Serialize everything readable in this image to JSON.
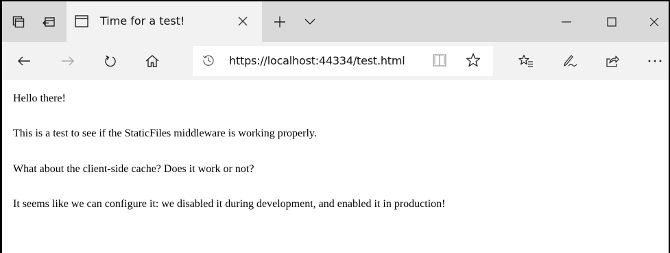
{
  "tab": {
    "title": "Time for a test!"
  },
  "address_bar": {
    "url": "https://localhost:44334/test.html"
  },
  "page": {
    "paragraphs": [
      "Hello there!",
      "This is a test to see if the StaticFiles middleware is working properly.",
      "What about the client-side cache? Does it work or not?",
      "It seems like we can configure it: we disabled it during development, and enabled it in production!"
    ]
  },
  "icons": {
    "tab_preview": "tabs-aside-icon",
    "set_aside": "set-tabs-aside-icon",
    "page": "page-icon",
    "close_tab": "close-icon",
    "new_tab": "plus-icon",
    "tab_list": "chevron-down-icon",
    "minimize": "minimize-icon",
    "maximize": "maximize-icon",
    "close_window": "close-window-icon",
    "back": "back-arrow-icon",
    "forward": "forward-arrow-icon",
    "refresh": "refresh-icon",
    "home": "home-icon",
    "history": "history-icon",
    "reading_view": "book-icon",
    "favorite": "star-icon",
    "favorites_hub": "favorites-list-icon",
    "notes": "pen-icon",
    "share": "share-icon",
    "more": "ellipsis-icon"
  },
  "colors": {
    "tabbar_bg": "#d9d9d9",
    "active_tab_bg": "#f2f2f2",
    "toolbar_bg": "#f2f2f2",
    "address_bg": "#ffffff",
    "forward_disabled": "#a6a6a6"
  }
}
